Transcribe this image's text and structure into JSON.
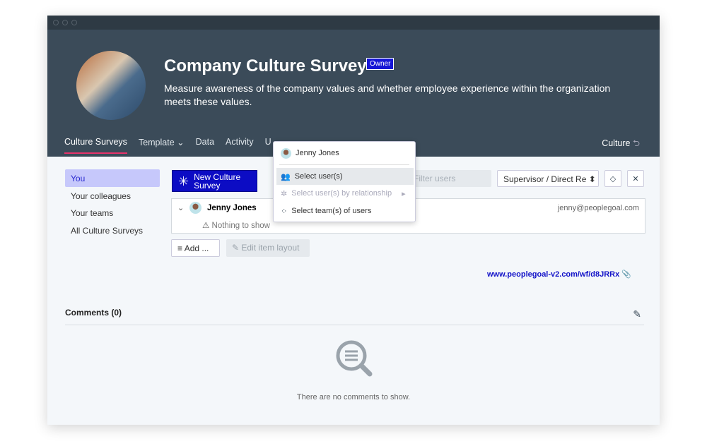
{
  "header": {
    "title": "Company Culture Survey",
    "badge": "Owner",
    "description": "Measure awareness of the company values and whether employee experience within the organization meets these values."
  },
  "tabs": [
    {
      "label": "Culture Surveys"
    },
    {
      "label": "Template"
    },
    {
      "label": "Data"
    },
    {
      "label": "Activity"
    },
    {
      "label": "U"
    }
  ],
  "back_label": "Culture",
  "sidebar": {
    "items": [
      {
        "label": "You"
      },
      {
        "label": "Your colleagues"
      },
      {
        "label": "Your teams"
      },
      {
        "label": "All Culture Surveys"
      }
    ]
  },
  "toolbar": {
    "new_label": "New Culture Survey",
    "filter_placeholder": "Filter users",
    "select_value": "Supervisor / Direct Re"
  },
  "user": {
    "name": "Jenny Jones",
    "email": "jenny@peoplegoal.com",
    "empty": "Nothing to show"
  },
  "actions": {
    "add": "Add ...",
    "edit": "Edit item layout"
  },
  "link": "www.peoplegoal-v2.com/wf/d8JRRx",
  "comments": {
    "title": "Comments (0)",
    "empty": "There are no comments to show."
  },
  "menu": {
    "user": "Jenny Jones",
    "items": [
      {
        "label": "Select user(s)"
      },
      {
        "label": "Select user(s) by relationship"
      },
      {
        "label": "Select team(s) of users"
      }
    ]
  },
  "colors": {
    "accent": "#0c0cc4",
    "header": "#3b4b59",
    "tab_indicator": "#e8336b"
  }
}
